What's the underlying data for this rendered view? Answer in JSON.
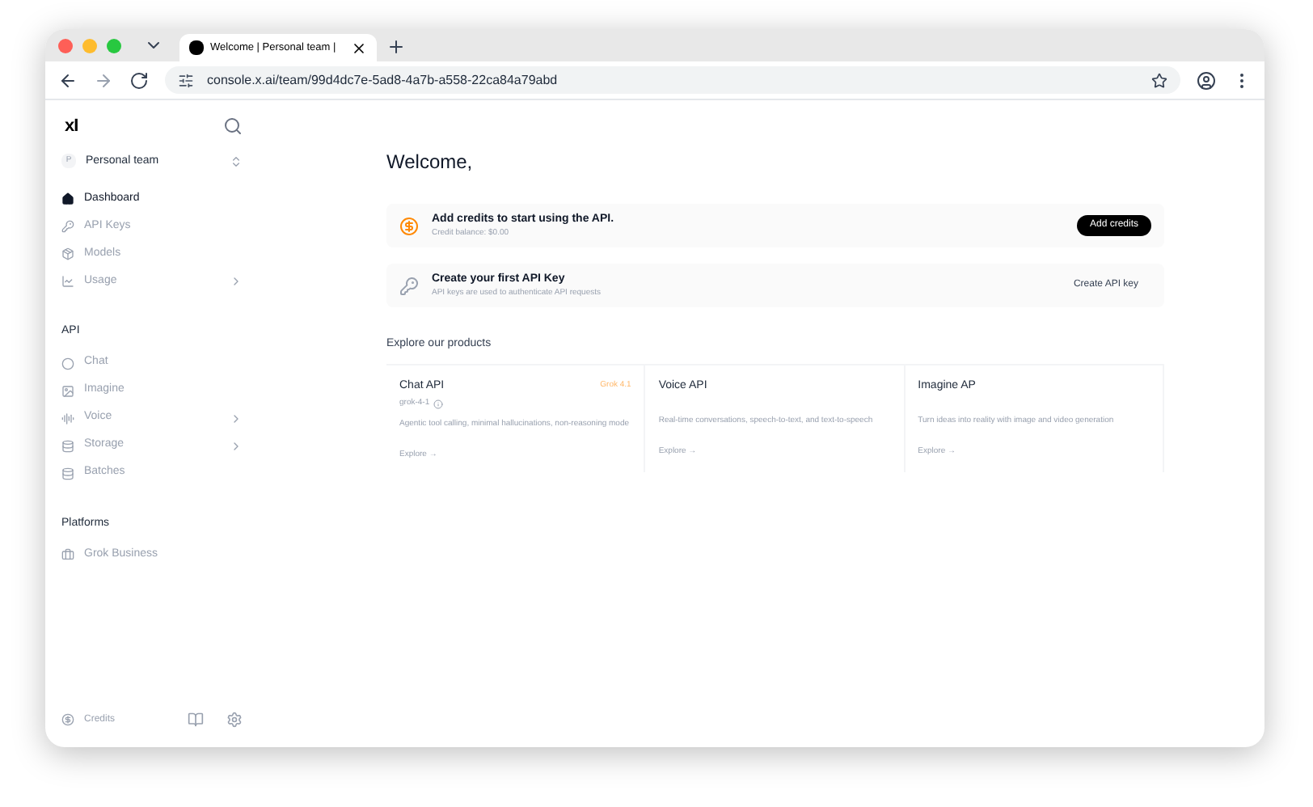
{
  "browser": {
    "tab_title": "Welcome | Personal team |",
    "url": "console.x.ai/team/99d4dc7e-5ad8-4a7b-a558-22ca84a79abd"
  },
  "sidebar": {
    "logo": "xI",
    "team": {
      "initial": "P",
      "name": "Personal team"
    },
    "sections": [
      {
        "items": [
          {
            "label": "Dashboard",
            "selected": true,
            "expandable": false
          },
          {
            "label": "API Keys",
            "selected": false,
            "expandable": false
          },
          {
            "label": "Models",
            "selected": false,
            "expandable": false
          },
          {
            "label": "Usage",
            "selected": false,
            "expandable": true
          }
        ]
      },
      {
        "title": "API",
        "items": [
          {
            "label": "Chat",
            "selected": false,
            "expandable": false
          },
          {
            "label": "Imagine",
            "selected": false,
            "expandable": false
          },
          {
            "label": "Voice",
            "selected": false,
            "expandable": true
          },
          {
            "label": "Storage",
            "selected": false,
            "expandable": true
          },
          {
            "label": "Batches",
            "selected": false,
            "expandable": false
          }
        ]
      },
      {
        "title": "Platforms",
        "items": [
          {
            "label": "Grok Business",
            "selected": false,
            "expandable": false
          }
        ]
      }
    ],
    "footer": {
      "label": "Credits"
    }
  },
  "main": {
    "heading": "Welcome,",
    "banners": [
      {
        "kind": "credits",
        "title": "Add credits to start using the API.",
        "subtitle": "Credit balance: $0.00",
        "button": "Add credits"
      },
      {
        "kind": "key",
        "title": "Create your first API Key",
        "subtitle": "API keys are used to authenticate API requests",
        "button": "Create API key"
      }
    ],
    "products_title": "Explore our products",
    "products": [
      {
        "title": "Chat API",
        "badge": "Grok 4.1",
        "model": "grok-4-1",
        "description": "Agentic tool calling, minimal hallucinations, non-reasoning mode",
        "link": "Explore →"
      },
      {
        "title": "Voice API",
        "description": "Real-time conversations, speech-to-text, and text-to-speech",
        "link": "Explore →"
      },
      {
        "title": "Imagine AP",
        "description": "Turn ideas into reality with image and video generation",
        "link": "Explore →"
      }
    ]
  }
}
